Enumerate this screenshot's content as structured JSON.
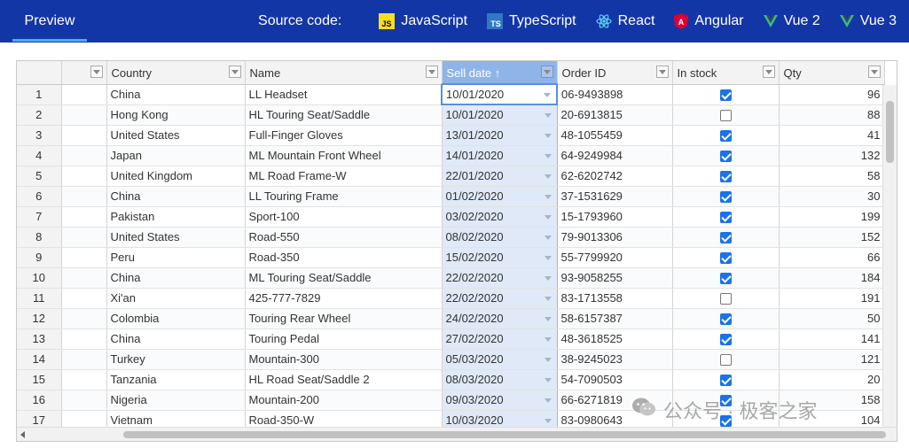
{
  "topbar": {
    "preview_label": "Preview",
    "source_label": "Source code:",
    "links": [
      {
        "label": "JavaScript",
        "icon": "js-icon"
      },
      {
        "label": "TypeScript",
        "icon": "ts-icon"
      },
      {
        "label": "React",
        "icon": "react-icon"
      },
      {
        "label": "Angular",
        "icon": "angular-icon"
      },
      {
        "label": "Vue 2",
        "icon": "vue-icon"
      },
      {
        "label": "Vue 3",
        "icon": "vue-icon"
      }
    ],
    "bg_color": "#1336a6"
  },
  "grid": {
    "columns": [
      "",
      "Country",
      "Name",
      "Sell date",
      "Order ID",
      "In stock",
      "Qty"
    ],
    "sort_indicator": "↑",
    "rows": [
      {
        "n": "1",
        "country": "China",
        "name": "LL Headset",
        "date": "10/01/2020",
        "order": "06-9493898",
        "stock": true,
        "qty": "96"
      },
      {
        "n": "2",
        "country": "Hong Kong",
        "name": "HL Touring Seat/Saddle",
        "date": "10/01/2020",
        "order": "20-6913815",
        "stock": false,
        "qty": "88"
      },
      {
        "n": "3",
        "country": "United States",
        "name": "Full-Finger Gloves",
        "date": "13/01/2020",
        "order": "48-1055459",
        "stock": true,
        "qty": "41"
      },
      {
        "n": "4",
        "country": "Japan",
        "name": "ML Mountain Front Wheel",
        "date": "14/01/2020",
        "order": "64-9249984",
        "stock": true,
        "qty": "132"
      },
      {
        "n": "5",
        "country": "United Kingdom",
        "name": "ML Road Frame-W",
        "date": "22/01/2020",
        "order": "62-6202742",
        "stock": true,
        "qty": "58"
      },
      {
        "n": "6",
        "country": "China",
        "name": "LL Touring Frame",
        "date": "01/02/2020",
        "order": "37-1531629",
        "stock": true,
        "qty": "30"
      },
      {
        "n": "7",
        "country": "Pakistan",
        "name": "Sport-100",
        "date": "03/02/2020",
        "order": "15-1793960",
        "stock": true,
        "qty": "199"
      },
      {
        "n": "8",
        "country": "United States",
        "name": "Road-550",
        "date": "08/02/2020",
        "order": "79-9013306",
        "stock": true,
        "qty": "152"
      },
      {
        "n": "9",
        "country": "Peru",
        "name": "Road-350",
        "date": "15/02/2020",
        "order": "55-7799920",
        "stock": true,
        "qty": "66"
      },
      {
        "n": "10",
        "country": "China",
        "name": "ML Touring Seat/Saddle",
        "date": "22/02/2020",
        "order": "93-9058255",
        "stock": true,
        "qty": "184"
      },
      {
        "n": "11",
        "country": "Xi'an",
        "name": "425-777-7829",
        "date": "22/02/2020",
        "order": "83-1713558",
        "stock": false,
        "qty": "191"
      },
      {
        "n": "12",
        "country": "Colombia",
        "name": "Touring Rear Wheel",
        "date": "24/02/2020",
        "order": "58-6157387",
        "stock": true,
        "qty": "50"
      },
      {
        "n": "13",
        "country": "China",
        "name": "Touring Pedal",
        "date": "27/02/2020",
        "order": "48-3618525",
        "stock": true,
        "qty": "141"
      },
      {
        "n": "14",
        "country": "Turkey",
        "name": "Mountain-300",
        "date": "05/03/2020",
        "order": "38-9245023",
        "stock": false,
        "qty": "121"
      },
      {
        "n": "15",
        "country": "Tanzania",
        "name": "HL Road Seat/Saddle 2",
        "date": "08/03/2020",
        "order": "54-7090503",
        "stock": true,
        "qty": "20"
      },
      {
        "n": "16",
        "country": "Nigeria",
        "name": "Mountain-200",
        "date": "09/03/2020",
        "order": "66-6271819",
        "stock": true,
        "qty": "158"
      },
      {
        "n": "17",
        "country": "Vietnam",
        "name": "Road-350-W",
        "date": "10/03/2020",
        "order": "83-0980643",
        "stock": true,
        "qty": "104"
      }
    ]
  },
  "watermark": {
    "text": "公众号 · 极客之家",
    "icon": "wechat-icon"
  }
}
